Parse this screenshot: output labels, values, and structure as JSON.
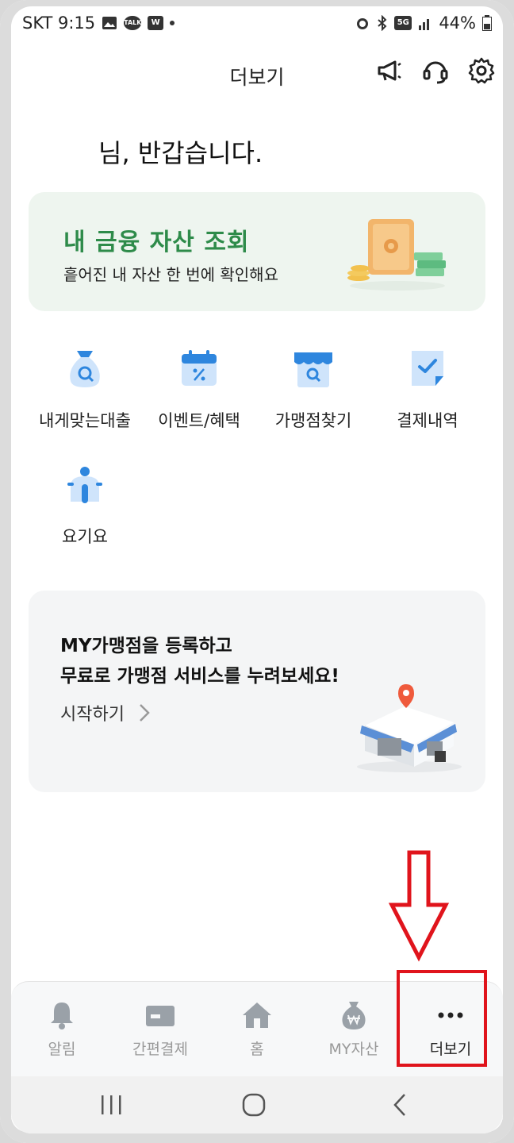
{
  "status_bar": {
    "carrier_time": "SKT 9:15",
    "talk_badge": "TALK",
    "w_badge": "W",
    "net": "5G",
    "battery": "44%"
  },
  "header": {
    "title": "더보기",
    "icons": [
      "megaphone-icon",
      "headset-icon",
      "gear-icon"
    ]
  },
  "greeting": "님, 반갑습니다.",
  "asset_card": {
    "title": "내 금융 자산 조회",
    "subtitle": "흩어진 내 자산 한 번에 확인해요"
  },
  "menu": [
    {
      "label": "내게맞는대출",
      "icon": "loan-bag-icon"
    },
    {
      "label": "이벤트/혜택",
      "icon": "calendar-percent-icon"
    },
    {
      "label": "가맹점찾기",
      "icon": "store-search-icon"
    },
    {
      "label": "결제내역",
      "icon": "receipt-check-icon"
    },
    {
      "label": "요기요",
      "icon": "scooter-icon"
    }
  ],
  "promo": {
    "line1": "MY가맹점을 등록하고",
    "line2": "무료로 가맹점 서비스를 누려보세요!",
    "start": "시작하기"
  },
  "bottom_nav": [
    {
      "label": "알림",
      "icon": "bell-icon"
    },
    {
      "label": "간편결제",
      "icon": "card-icon"
    },
    {
      "label": "홈",
      "icon": "home-icon"
    },
    {
      "label": "MY자산",
      "icon": "won-bag-icon"
    },
    {
      "label": "더보기",
      "icon": "more-icon"
    }
  ],
  "colors": {
    "accent_green": "#2e8b4a",
    "accent_blue": "#2e86de",
    "annotation_red": "#e0141c"
  }
}
